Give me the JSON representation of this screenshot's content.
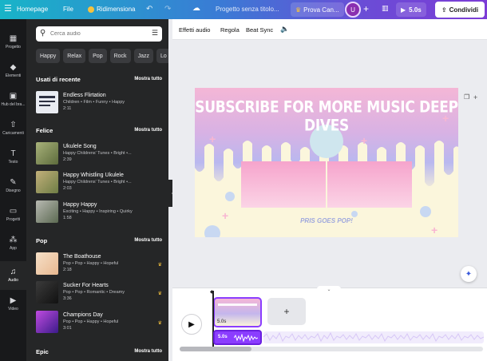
{
  "topbar": {
    "menu_icon": "hamburger-icon",
    "home": "Homepage",
    "file": "File",
    "resize": "Ridimensiona",
    "doc_title": "Progetto senza titolo...",
    "try_pro": "Prova Can...",
    "avatar": "U",
    "duration": "5.0s",
    "share": "Condividi"
  },
  "rail": [
    {
      "label": "Progetto",
      "icon": "layout-icon"
    },
    {
      "label": "Elementi",
      "icon": "shapes-icon"
    },
    {
      "label": "Hub del bra...",
      "icon": "brand-icon"
    },
    {
      "label": "Caricamenti",
      "icon": "upload-icon"
    },
    {
      "label": "Testo",
      "icon": "text-icon"
    },
    {
      "label": "Disegno",
      "icon": "draw-icon"
    },
    {
      "label": "Progetti",
      "icon": "folder-icon"
    },
    {
      "label": "App",
      "icon": "apps-icon"
    },
    {
      "label": "Audio",
      "icon": "music-icon"
    },
    {
      "label": "Video",
      "icon": "video-icon"
    }
  ],
  "panel": {
    "search_placeholder": "Cerca audio",
    "chips": [
      "Happy",
      "Relax",
      "Pop",
      "Rock",
      "Jazz",
      "Lo"
    ],
    "see_all": "Mostra tutto",
    "sections": [
      {
        "title": "Usati di recente",
        "tracks": [
          {
            "title": "Endless Flirtation",
            "meta": "Children • Film • Funny • Happy",
            "duration": "2:11"
          }
        ]
      },
      {
        "title": "Felice",
        "tracks": [
          {
            "title": "Ukulele Song",
            "meta": "Happy Childrens' Tunes • Bright •...",
            "duration": "2:39"
          },
          {
            "title": "Happy Whistling Ukulele",
            "meta": "Happy Childrens' Tunes • Bright •...",
            "duration": "2:03"
          },
          {
            "title": "Happy Happy",
            "meta": "Exciting • Happy • Inspiring • Quirky",
            "duration": "1:58"
          }
        ]
      },
      {
        "title": "Pop",
        "tracks": [
          {
            "title": "The Boathouse",
            "meta": "Pop • Pop • Happy • Hopeful",
            "duration": "2:18"
          },
          {
            "title": "Sucker For Hearts",
            "meta": "Pop • Pop • Romantic • Dreamy",
            "duration": "3:36"
          },
          {
            "title": "Champions Day",
            "meta": "Pop • Pop • Happy • Hopeful",
            "duration": "3:01"
          }
        ]
      },
      {
        "title": "Epic",
        "tracks": []
      }
    ]
  },
  "toolbar": {
    "effects": "Effetti audio",
    "adjust": "Regola",
    "beat_sync": "Beat Sync"
  },
  "design": {
    "title": "SUBSCRIBE FOR MORE MUSIC DEEP DIVES",
    "subtitle": "PRIS GOES POP!"
  },
  "timeline": {
    "clip_duration": "5.0s",
    "audio_duration": "5.0s",
    "add_label": "+"
  },
  "colors": {
    "accent": "#8b3dff",
    "panel_bg": "#252627",
    "rail_bg": "#18191b",
    "crown": "#f6c23e"
  }
}
